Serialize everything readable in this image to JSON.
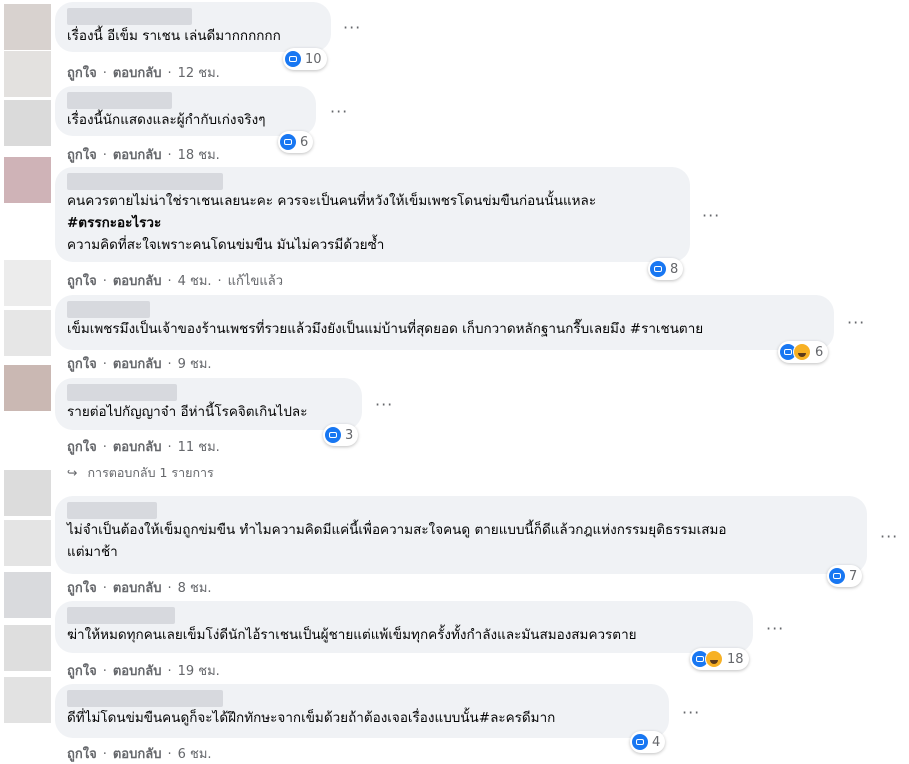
{
  "ui": {
    "like_label": "ถูกใจ",
    "reply_label": "ตอบกลับ",
    "more": "···",
    "sep": "·"
  },
  "comments": [
    {
      "text_lines": [
        "เรื่องนี้ อีเข็ม ราเชน เล่นดีมากกกกกก"
      ],
      "reactions": [
        "like"
      ],
      "count": "10",
      "time": "12 ชม.",
      "edited": ""
    },
    {
      "text_lines": [
        "เรื่องนี้นักแสดงและผู้กำกับเก่งจริงๆ"
      ],
      "reactions": [
        "like"
      ],
      "count": "6",
      "time": "18 ชม.",
      "edited": ""
    },
    {
      "text_lines": [
        "คนควรตายไม่น่าใช่ราเชนเลยนะคะ ควรจะเป็นคนที่หวังให้เข็มเพชรโดนข่มขืนก่อนนั้นแหละ",
        "#ตรรกะอะไรวะ",
        "ความคิดที่สะใจเพราะคนโดนข่มขืน มันไม่ควรมีด้วยซ้ำ"
      ],
      "reactions": [
        "like"
      ],
      "count": "8",
      "time": "4 ชม.",
      "edited": "แก้ไขแล้ว"
    },
    {
      "text_lines": [
        "เข็มเพชรมึงเป็นเจ้าของร้านเพชรที่รวยแล้วมึงยังเป็นแม่บ้านที่สุดยอด เก็บกวาดหลักฐานกรื๊บเลยมึง #ราเชนตาย"
      ],
      "reactions": [
        "like",
        "haha"
      ],
      "count": "6",
      "time": "9 ชม.",
      "edited": ""
    },
    {
      "text_lines": [
        "รายต่อไปกัญญาจ๋า อีห่านี้โรคจิตเกินไปละ"
      ],
      "reactions": [
        "like"
      ],
      "count": "3",
      "time": "11 ชม.",
      "edited": "",
      "replies_link": "การตอบกลับ 1 รายการ"
    },
    {
      "text_lines": [
        "ไม่จำเป็นต้องให้เข็มถูกข่มขืน ทำไมความคิดมีแค่นี้เพื่อความสะใจคนดู ตายแบบนี้ก็ดีแล้วกฎแห่งกรรมยุติธรรมเสมอ",
        "แต่มาช้า"
      ],
      "reactions": [
        "like"
      ],
      "count": "7",
      "time": "8 ชม.",
      "edited": ""
    },
    {
      "text_lines": [
        "ฆ่าให้หมดทุกคนเลยเข็มโง่ดีนักไอ้ราเชนเป็นผู้ชายแต่แพ้เข็มทุกครั้งทั้งกำลังและมันสมองสมควรตาย"
      ],
      "reactions": [
        "like",
        "haha"
      ],
      "count": "18",
      "time": "19 ชม.",
      "edited": ""
    },
    {
      "text_lines": [
        "ดีที่ไม่โดนข่มขืนคนดูก็จะได้ฝึกทักษะจากเข็มด้วยถ้าต้องเจอเรื่องแบบนั้น#ละครดีมาก"
      ],
      "reactions": [
        "like"
      ],
      "count": "4",
      "time": "6 ชม.",
      "edited": ""
    }
  ],
  "colors": {
    "bubble": "#f0f2f5",
    "like_blue": "#1877f2",
    "meta_gray": "#65676b",
    "haha_yellow": "#f7b125"
  }
}
